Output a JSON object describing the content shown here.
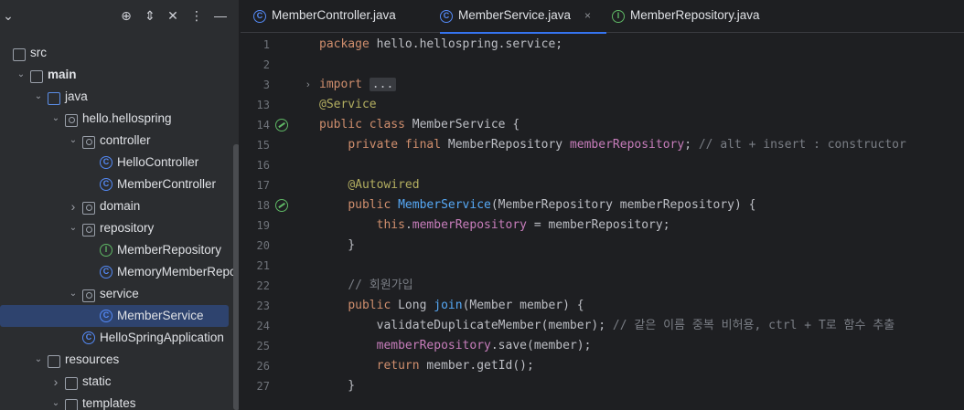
{
  "sidebar": {
    "toolbar_icons": [
      "locate-icon",
      "expand-icon",
      "collapse-icon",
      "more-icon",
      "minimize-icon"
    ],
    "tree": [
      {
        "label": "src",
        "depth": 0,
        "icon": "folder",
        "chevron": ""
      },
      {
        "label": "main",
        "depth": 1,
        "icon": "folder",
        "chevron": "down"
      },
      {
        "label": "java",
        "depth": 2,
        "icon": "folder-blue",
        "chevron": "down"
      },
      {
        "label": "hello.hellospring",
        "depth": 3,
        "icon": "package",
        "chevron": "down"
      },
      {
        "label": "controller",
        "depth": 4,
        "icon": "package",
        "chevron": "down"
      },
      {
        "label": "HelloController",
        "depth": 5,
        "icon": "class",
        "chevron": ""
      },
      {
        "label": "MemberController",
        "depth": 5,
        "icon": "class",
        "chevron": ""
      },
      {
        "label": "domain",
        "depth": 4,
        "icon": "package",
        "chevron": "right"
      },
      {
        "label": "repository",
        "depth": 4,
        "icon": "package",
        "chevron": "down"
      },
      {
        "label": "MemberRepository",
        "depth": 5,
        "icon": "interface",
        "chevron": ""
      },
      {
        "label": "MemoryMemberReposito",
        "depth": 5,
        "icon": "class",
        "chevron": ""
      },
      {
        "label": "service",
        "depth": 4,
        "icon": "package",
        "chevron": "down"
      },
      {
        "label": "MemberService",
        "depth": 5,
        "icon": "class",
        "chevron": "",
        "selected": true
      },
      {
        "label": "HelloSpringApplication",
        "depth": 4,
        "icon": "class",
        "chevron": ""
      },
      {
        "label": "resources",
        "depth": 2,
        "icon": "folder",
        "chevron": "down"
      },
      {
        "label": "static",
        "depth": 3,
        "icon": "folder",
        "chevron": "right"
      },
      {
        "label": "templates",
        "depth": 3,
        "icon": "folder",
        "chevron": "down"
      }
    ]
  },
  "tabs": [
    {
      "label": "MemberController.java",
      "icon": "class",
      "active": false
    },
    {
      "label": "MemberService.java",
      "icon": "class",
      "active": true,
      "close": "×"
    },
    {
      "label": "MemberRepository.java",
      "icon": "interface",
      "active": false
    }
  ],
  "editor": {
    "lines": [
      {
        "n": "1",
        "tokens": [
          [
            "kw",
            "package "
          ],
          [
            "txt",
            "hello.hellospring.service;"
          ]
        ]
      },
      {
        "n": "2",
        "tokens": []
      },
      {
        "n": "3",
        "fold": "›",
        "tokens": [
          [
            "kw",
            "import "
          ],
          [
            "foldbox",
            "..."
          ]
        ]
      },
      {
        "n": "13",
        "tokens": [
          [
            "ann",
            "@Service"
          ]
        ]
      },
      {
        "n": "14",
        "gutter_icon": true,
        "tokens": [
          [
            "kw",
            "public class "
          ],
          [
            "txt",
            "MemberService {"
          ]
        ]
      },
      {
        "n": "15",
        "tokens": [
          [
            "txt",
            "    "
          ],
          [
            "kw",
            "private final "
          ],
          [
            "txt",
            "MemberRepository "
          ],
          [
            "fld",
            "memberRepository"
          ],
          [
            "txt",
            "; "
          ],
          [
            "cm",
            "// alt + insert : constructor"
          ]
        ]
      },
      {
        "n": "16",
        "tokens": []
      },
      {
        "n": "17",
        "tokens": [
          [
            "txt",
            "    "
          ],
          [
            "ann",
            "@Autowired"
          ]
        ]
      },
      {
        "n": "18",
        "gutter_icon": true,
        "tokens": [
          [
            "txt",
            "    "
          ],
          [
            "kw",
            "public "
          ],
          [
            "fn",
            "MemberService"
          ],
          [
            "txt",
            "(MemberRepository memberRepository) {"
          ]
        ]
      },
      {
        "n": "19",
        "tokens": [
          [
            "txt",
            "        "
          ],
          [
            "kw",
            "this"
          ],
          [
            "txt",
            "."
          ],
          [
            "fld",
            "memberRepository"
          ],
          [
            "txt",
            " = memberRepository;"
          ]
        ]
      },
      {
        "n": "20",
        "tokens": [
          [
            "txt",
            "    }"
          ]
        ]
      },
      {
        "n": "21",
        "tokens": []
      },
      {
        "n": "22",
        "tokens": [
          [
            "txt",
            "    "
          ],
          [
            "cm",
            "// 회원가입"
          ]
        ]
      },
      {
        "n": "23",
        "tokens": [
          [
            "txt",
            "    "
          ],
          [
            "kw",
            "public "
          ],
          [
            "txt",
            "Long "
          ],
          [
            "fn",
            "join"
          ],
          [
            "txt",
            "(Member member) {"
          ]
        ]
      },
      {
        "n": "24",
        "tokens": [
          [
            "txt",
            "        validateDuplicateMember(member); "
          ],
          [
            "cm",
            "// 같은 이름 중복 비허용, ctrl + T로 함수 추출"
          ]
        ]
      },
      {
        "n": "25",
        "tokens": [
          [
            "txt",
            "        "
          ],
          [
            "fld",
            "memberRepository"
          ],
          [
            "txt",
            ".save(member);"
          ]
        ]
      },
      {
        "n": "26",
        "tokens": [
          [
            "txt",
            "        "
          ],
          [
            "kw",
            "return "
          ],
          [
            "txt",
            "member.getId();"
          ]
        ]
      },
      {
        "n": "27",
        "tokens": [
          [
            "txt",
            "    }"
          ]
        ]
      }
    ]
  }
}
